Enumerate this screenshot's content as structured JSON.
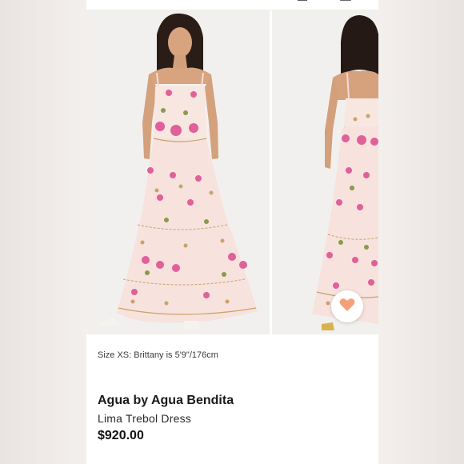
{
  "product": {
    "size_note": "Size XS: Brittany is 5'9\"/176cm",
    "brand": "Agua by Agua Bendita",
    "name": "Lima Trebol Dress",
    "price": "$920.00"
  },
  "icons": {
    "topbar": [
      "account-icon",
      "bag-icon"
    ],
    "favorite": "heart-icon"
  },
  "colors": {
    "heart": "#f5a07a",
    "dress": "#f7e3df",
    "flower": "#e0609a",
    "leaf": "#8a9a4a"
  }
}
